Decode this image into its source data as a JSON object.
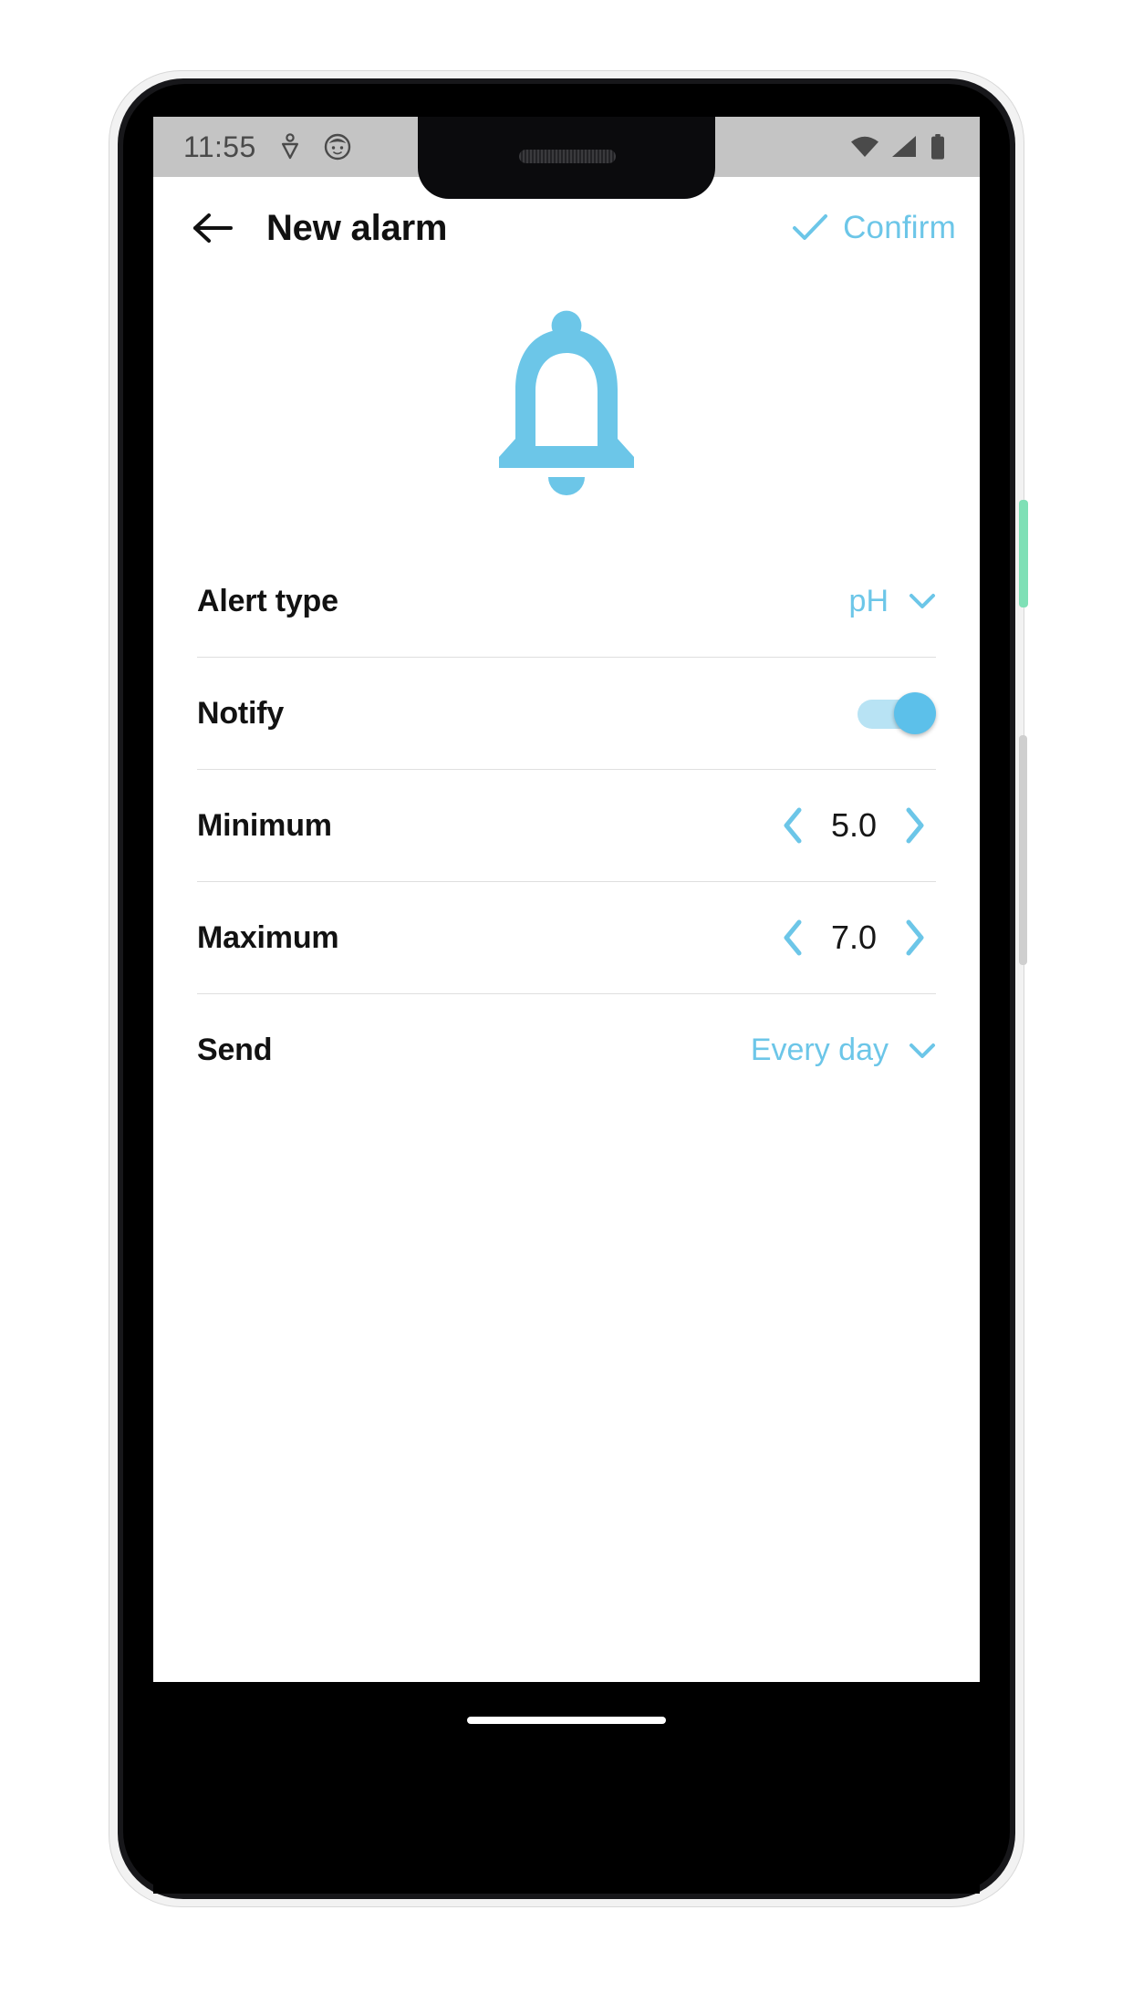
{
  "status_bar": {
    "time": "11:55",
    "left_icons": [
      "location-pin-icon",
      "face-avatar-icon"
    ],
    "right_icons": [
      "wifi-icon",
      "cellular-signal-icon",
      "battery-icon"
    ],
    "background_color": "#c4c4c4",
    "icon_color": "#4a4a4a"
  },
  "app_bar": {
    "back_icon": "arrow-left-icon",
    "title": "New alarm",
    "confirm": {
      "icon": "check-icon",
      "label": "Confirm"
    }
  },
  "hero": {
    "icon": "bell-icon",
    "color": "#6cc6e8"
  },
  "rows": [
    {
      "name": "alert-type",
      "label": "Alert type",
      "control": "dropdown",
      "value": "pH",
      "chevron": "chevron-down-icon"
    },
    {
      "name": "notify",
      "label": "Notify",
      "control": "toggle",
      "value": "on"
    },
    {
      "name": "minimum",
      "label": "Minimum",
      "control": "stepper",
      "value": "5.0",
      "decrement_icon": "chevron-left-icon",
      "increment_icon": "chevron-right-icon"
    },
    {
      "name": "maximum",
      "label": "Maximum",
      "control": "stepper",
      "value": "7.0",
      "decrement_icon": "chevron-left-icon",
      "increment_icon": "chevron-right-icon"
    },
    {
      "name": "send",
      "label": "Send",
      "control": "dropdown",
      "value": "Every day",
      "chevron": "chevron-down-icon"
    }
  ],
  "nav_bar": {
    "gesture_pill": "home-gesture-pill"
  },
  "theme": {
    "accent": "#6cc6e8",
    "accent_light": "#b8e3f4",
    "text": "#121212",
    "divider": "#dfdfdf",
    "background": "#ffffff"
  },
  "device": {
    "power_button_color": "#7fe0b6",
    "volume_button_color": "#cfcfcf"
  }
}
